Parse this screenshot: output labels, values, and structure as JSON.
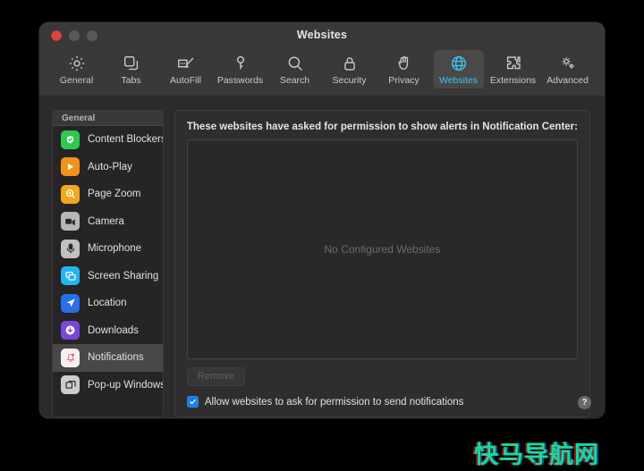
{
  "window": {
    "title": "Websites",
    "traffic_lights": [
      {
        "name": "close",
        "color": "#d6473d"
      },
      {
        "name": "minimize",
        "color": "#5a5758"
      },
      {
        "name": "maximize",
        "color": "#5a5758"
      }
    ]
  },
  "toolbar": {
    "items": [
      {
        "label": "General",
        "icon": "gear-icon",
        "active": false
      },
      {
        "label": "Tabs",
        "icon": "tabs-icon",
        "active": false
      },
      {
        "label": "AutoFill",
        "icon": "autofill-icon",
        "active": false
      },
      {
        "label": "Passwords",
        "icon": "key-icon",
        "active": false
      },
      {
        "label": "Search",
        "icon": "search-icon",
        "active": false
      },
      {
        "label": "Security",
        "icon": "lock-icon",
        "active": false
      },
      {
        "label": "Privacy",
        "icon": "hand-icon",
        "active": false
      },
      {
        "label": "Websites",
        "icon": "globe-icon",
        "active": true
      },
      {
        "label": "Extensions",
        "icon": "puzzle-icon",
        "active": false
      },
      {
        "label": "Advanced",
        "icon": "advanced-icon",
        "active": false
      }
    ],
    "active_accent": "#35c7f0"
  },
  "sidebar": {
    "header": "General",
    "items": [
      {
        "label": "Content Blockers",
        "icon": "shield-check-icon",
        "color": "#2ec951",
        "selected": false
      },
      {
        "label": "Auto-Play",
        "icon": "play-icon",
        "color": "#f09418",
        "selected": false
      },
      {
        "label": "Page Zoom",
        "icon": "magnifier-icon",
        "color": "#f0a81c",
        "selected": false
      },
      {
        "label": "Camera",
        "icon": "camera-icon",
        "color": "#b9b6b6",
        "selected": false
      },
      {
        "label": "Microphone",
        "icon": "microphone-icon",
        "color": "#c2bfbf",
        "selected": false
      },
      {
        "label": "Screen Sharing",
        "icon": "screen-share-icon",
        "color": "#22b6f0",
        "selected": false
      },
      {
        "label": "Location",
        "icon": "location-icon",
        "color": "#2a6ee8",
        "selected": false
      },
      {
        "label": "Downloads",
        "icon": "download-icon",
        "color": "#7a46d8",
        "selected": false
      },
      {
        "label": "Notifications",
        "icon": "bell-icon",
        "color": "#f4f0ee",
        "selected": true
      },
      {
        "label": "Pop-up Windows",
        "icon": "popup-window-icon",
        "color": "#cfcccc",
        "selected": false
      }
    ]
  },
  "main": {
    "prompt": "These websites have asked for permission to show alerts in Notification Center:",
    "empty_message": "No Configured Websites",
    "remove_button": "Remove",
    "remove_disabled": true,
    "allow_checkbox": {
      "label": "Allow websites to ask for permission to send notifications",
      "checked": true,
      "color": "#1a7fe3"
    }
  },
  "help": {
    "glyph": "?"
  },
  "watermark": {
    "text": "快马导航网",
    "color": "#17d9a0"
  }
}
